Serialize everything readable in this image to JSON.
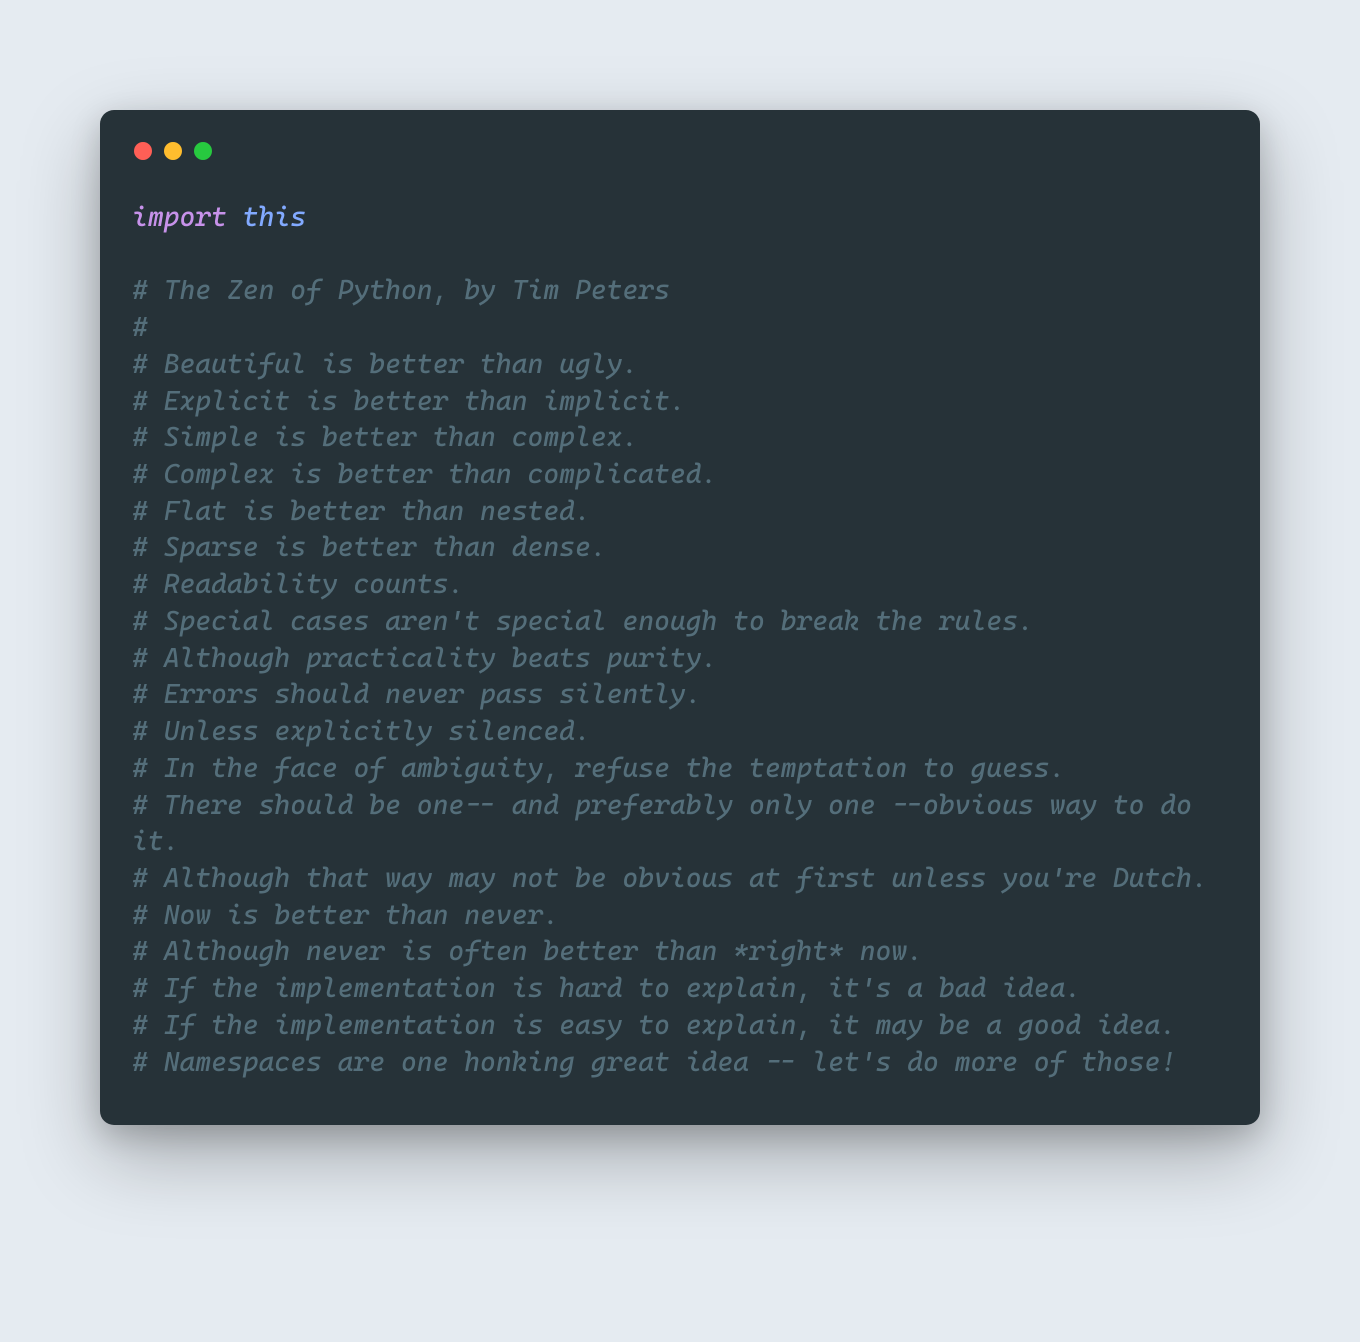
{
  "window": {
    "titlebar": {
      "close_color": "#ff5f56",
      "minimize_color": "#ffbd2e",
      "zoom_color": "#27c93f"
    }
  },
  "code": {
    "import_keyword": "import",
    "import_module": "this",
    "comments": [
      "# The Zen of Python, by Tim Peters",
      "#",
      "# Beautiful is better than ugly.",
      "# Explicit is better than implicit.",
      "# Simple is better than complex.",
      "# Complex is better than complicated.",
      "# Flat is better than nested.",
      "# Sparse is better than dense.",
      "# Readability counts.",
      "# Special cases aren't special enough to break the rules.",
      "# Although practicality beats purity.",
      "# Errors should never pass silently.",
      "# Unless explicitly silenced.",
      "# In the face of ambiguity, refuse the temptation to guess.",
      "# There should be one-- and preferably only one --obvious way to do it.",
      "# Although that way may not be obvious at first unless you're Dutch.",
      "# Now is better than never.",
      "# Although never is often better than *right* now.",
      "# If the implementation is hard to explain, it's a bad idea.",
      "# If the implementation is easy to explain, it may be a good idea.",
      "# Namespaces are one honking great idea -- let's do more of those!"
    ]
  }
}
